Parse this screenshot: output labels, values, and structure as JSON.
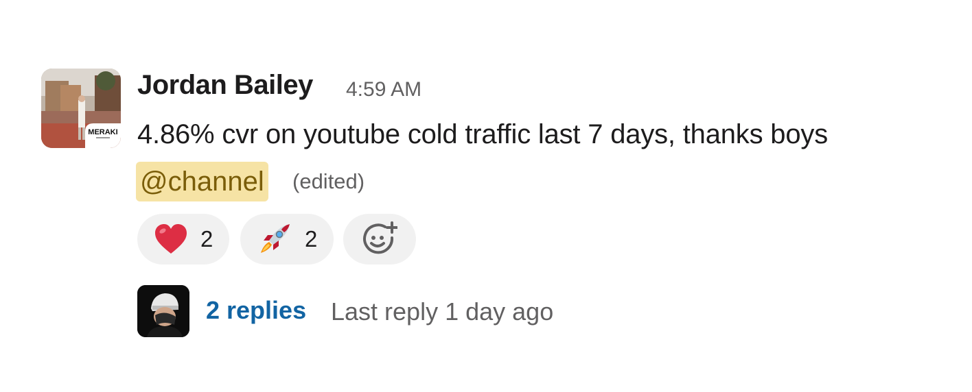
{
  "message": {
    "author": "Jordan Bailey",
    "timestamp": "4:59 AM",
    "text": "4.86% cvr on youtube cold traffic last 7 days, thanks boys",
    "mention": "@channel",
    "edited_label": "(edited)",
    "avatar_badge_text": "MERAKI"
  },
  "reactions": [
    {
      "emoji": "heart",
      "icon": "heart-icon",
      "count": "2"
    },
    {
      "emoji": "rocket",
      "icon": "rocket-icon",
      "count": "2"
    }
  ],
  "add_reaction": {
    "icon": "add-reaction-icon"
  },
  "thread": {
    "reply_count": "2 replies",
    "last_reply": "Last reply 1 day ago"
  },
  "colors": {
    "link_blue": "#1264a3",
    "mention_bg": "#f6e3a5",
    "mention_text": "#7a5d09",
    "reaction_bg": "#f1f1f1",
    "muted_text": "#616061"
  }
}
